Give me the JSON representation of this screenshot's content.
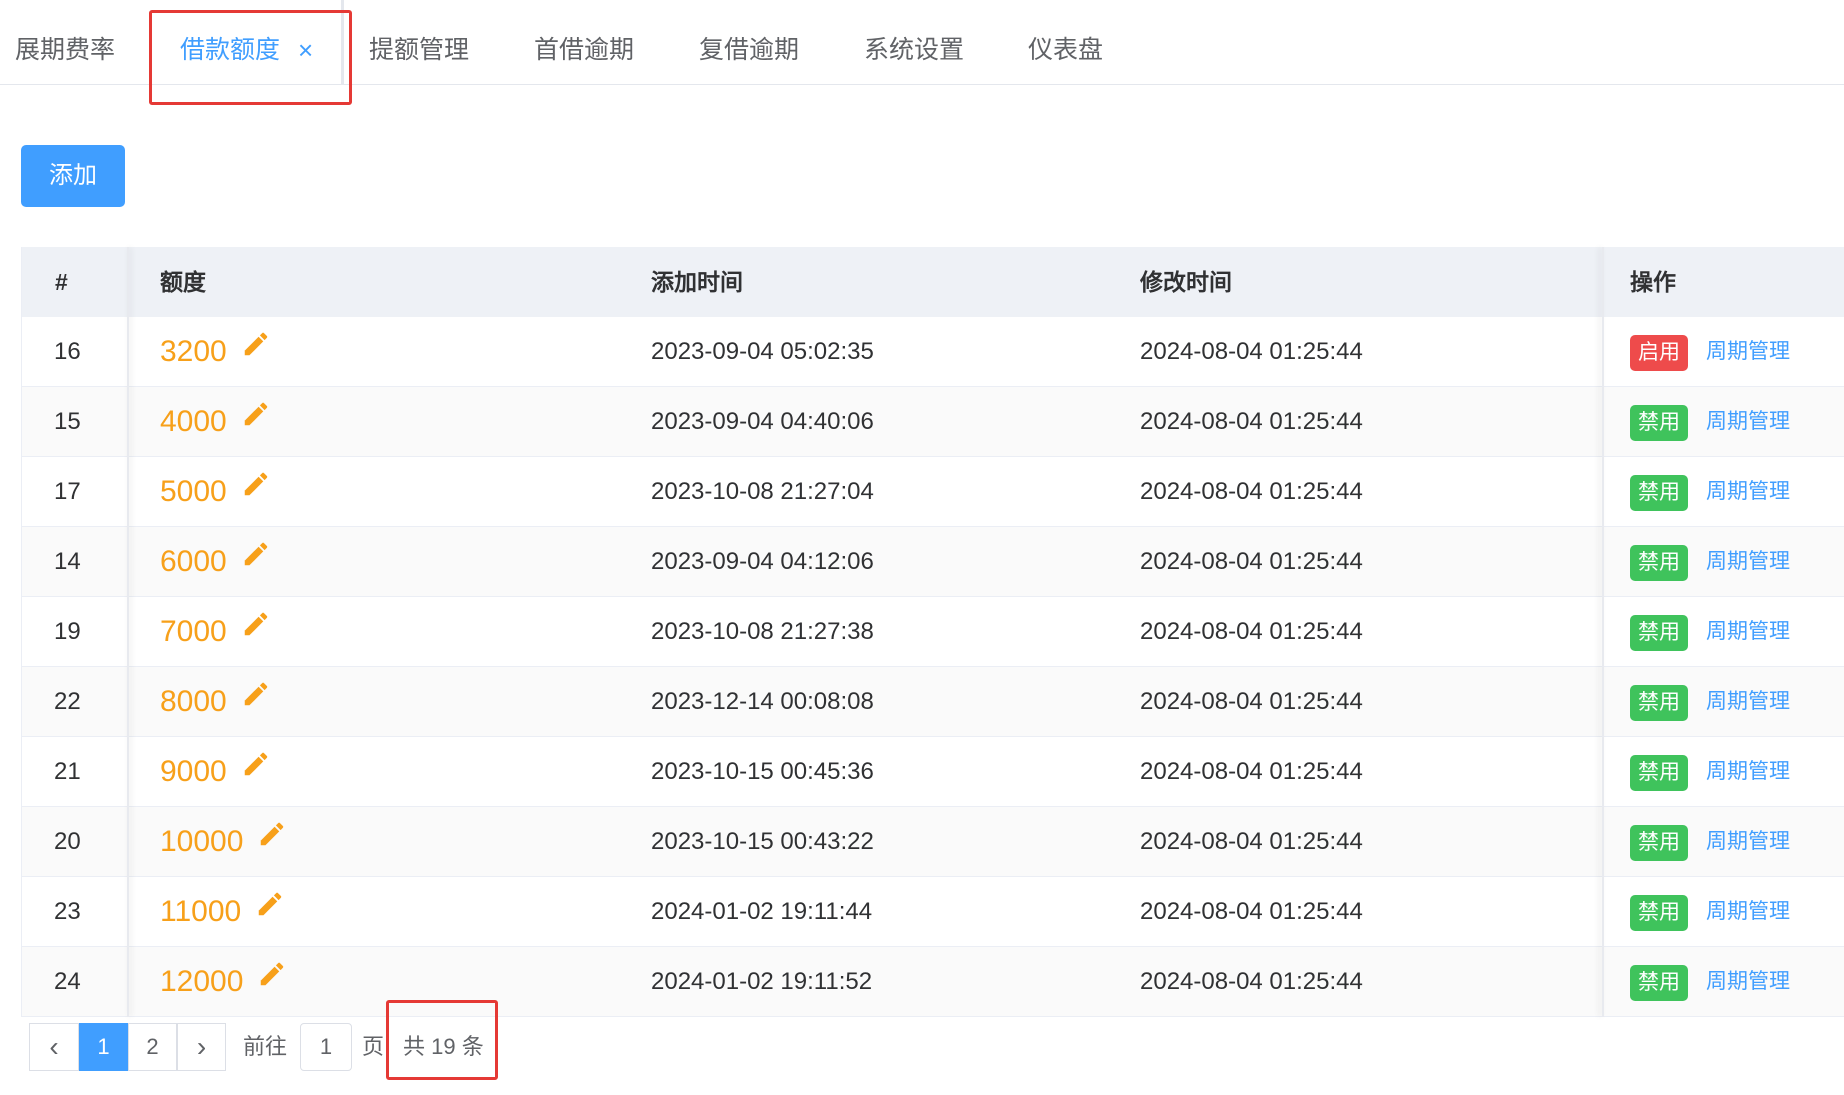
{
  "tabs": [
    {
      "label": "展期费率"
    },
    {
      "label": "借款额度"
    },
    {
      "label": "提额管理"
    },
    {
      "label": "首借逾期"
    },
    {
      "label": "复借逾期"
    },
    {
      "label": "系统设置"
    },
    {
      "label": "仪表盘"
    }
  ],
  "active_tab_close": "×",
  "add_button": "添加",
  "table": {
    "headers": [
      "#",
      "额度",
      "添加时间",
      "修改时间",
      "操作"
    ],
    "rows": [
      {
        "id": "16",
        "amount": "3200",
        "added": "2023-09-04 05:02:35",
        "modified": "2024-08-04 01:25:44",
        "status": "启用",
        "link": "周期管理"
      },
      {
        "id": "15",
        "amount": "4000",
        "added": "2023-09-04 04:40:06",
        "modified": "2024-08-04 01:25:44",
        "status": "禁用",
        "link": "周期管理"
      },
      {
        "id": "17",
        "amount": "5000",
        "added": "2023-10-08 21:27:04",
        "modified": "2024-08-04 01:25:44",
        "status": "禁用",
        "link": "周期管理"
      },
      {
        "id": "14",
        "amount": "6000",
        "added": "2023-09-04 04:12:06",
        "modified": "2024-08-04 01:25:44",
        "status": "禁用",
        "link": "周期管理"
      },
      {
        "id": "19",
        "amount": "7000",
        "added": "2023-10-08 21:27:38",
        "modified": "2024-08-04 01:25:44",
        "status": "禁用",
        "link": "周期管理"
      },
      {
        "id": "22",
        "amount": "8000",
        "added": "2023-12-14 00:08:08",
        "modified": "2024-08-04 01:25:44",
        "status": "禁用",
        "link": "周期管理"
      },
      {
        "id": "21",
        "amount": "9000",
        "added": "2023-10-15 00:45:36",
        "modified": "2024-08-04 01:25:44",
        "status": "禁用",
        "link": "周期管理"
      },
      {
        "id": "20",
        "amount": "10000",
        "added": "2023-10-15 00:43:22",
        "modified": "2024-08-04 01:25:44",
        "status": "禁用",
        "link": "周期管理"
      },
      {
        "id": "23",
        "amount": "11000",
        "added": "2024-01-02 19:11:44",
        "modified": "2024-08-04 01:25:44",
        "status": "禁用",
        "link": "周期管理"
      },
      {
        "id": "24",
        "amount": "12000",
        "added": "2024-01-02 19:11:52",
        "modified": "2024-08-04 01:25:44",
        "status": "禁用",
        "link": "周期管理"
      }
    ]
  },
  "pagination": {
    "prev": "‹",
    "pages": [
      "1",
      "2"
    ],
    "current_page": "1",
    "next": "›",
    "goto_label": "前往",
    "goto_value": "1",
    "page_suffix": "页",
    "total": "共 19 条"
  },
  "colors": {
    "primary": "#409eff",
    "amount": "#f7a01a",
    "enabled_tag": "#ee4b4b",
    "disabled_tag": "#3fc35c",
    "highlight_box": "#e53935"
  }
}
